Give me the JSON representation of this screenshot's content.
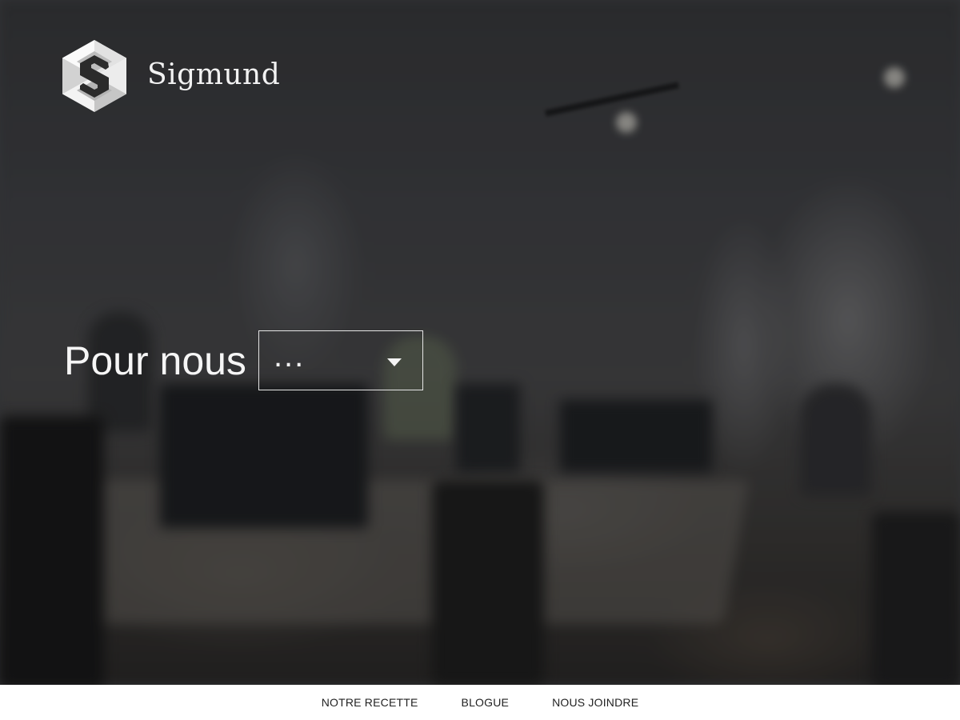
{
  "brand": {
    "logo_icon": "hexagon-s-logo",
    "name": "Sigmund"
  },
  "hero": {
    "label": "Pour nous",
    "select": {
      "value": "...",
      "icon": "caret-down-icon"
    }
  },
  "footer_nav": {
    "items": [
      {
        "label": "NOTRE RECETTE"
      },
      {
        "label": "BLOGUE"
      },
      {
        "label": "NOUS JOINDRE"
      }
    ]
  },
  "colors": {
    "text_on_hero": "#f2f2f2",
    "footer_bg": "#ffffff",
    "footer_text": "#222222"
  }
}
